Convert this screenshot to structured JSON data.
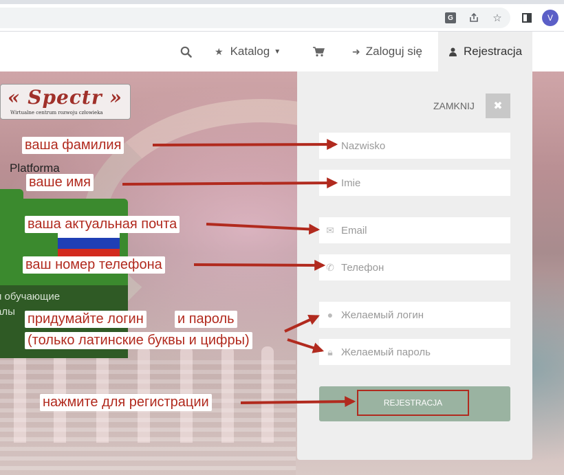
{
  "browser": {
    "avatar_letter": "V",
    "translate_glyph": "G"
  },
  "nav": {
    "katalog": "Katalog",
    "login": "Zaloguj się",
    "register": "Rejestracja"
  },
  "hero": {
    "logo_text": "« Spectr »",
    "logo_sub": "Wirtualne centrum rozwoju człowieka",
    "platform_label": "Platforma",
    "folder_line1": "и обучающие",
    "folder_line2": "алы",
    "flag_colors": [
      "#ffffff",
      "#1f3fb5",
      "#d22a1e"
    ]
  },
  "panel": {
    "close_label": "ZAMKNIJ",
    "fields": {
      "surname": "Nazwisko",
      "name": "Imie",
      "email": "Email",
      "phone": "Телефон",
      "login": "Желаемый логин",
      "password": "Желаемый пароль"
    },
    "submit_label": "REJESTRACJA"
  },
  "annotations": {
    "surname": "ваша фамилия",
    "name": "ваше имя",
    "email": "ваша актуальная почта",
    "phone": "ваш номер телефона",
    "login": "придумайте логин",
    "password": "и пароль",
    "latin_note": "(только латинские буквы и цифры)",
    "submit": "нажмите для регистрации"
  },
  "colors": {
    "annotation_red": "#b12a1e",
    "panel_bg": "#eeeeee",
    "submit_bg": "#9ab3a1"
  }
}
